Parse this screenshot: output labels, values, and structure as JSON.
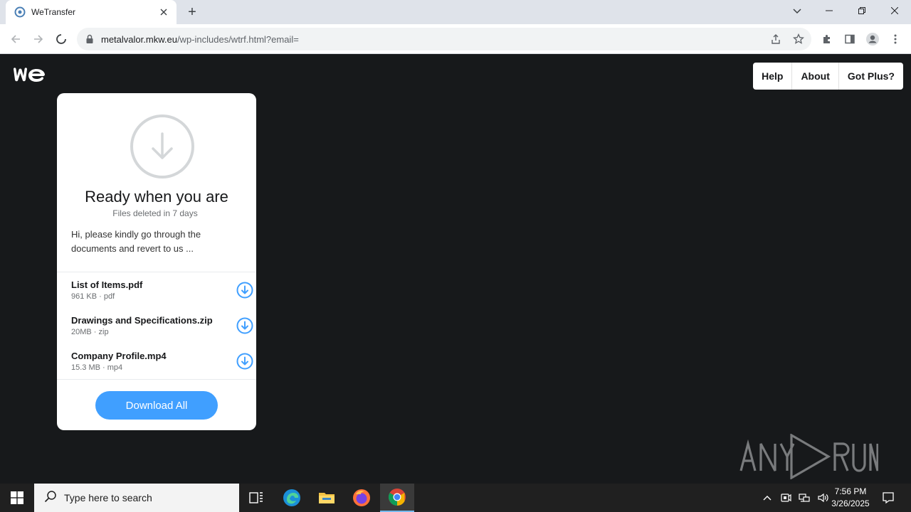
{
  "browser": {
    "tab_title": "WeTransfer",
    "new_tab_label": "+",
    "url_host": "metalvalor.mkw.eu",
    "url_path": "/wp-includes/wtrf.html?email="
  },
  "page": {
    "nav": [
      "Help",
      "About",
      "Got Plus?"
    ],
    "card": {
      "heading": "Ready when you are",
      "subheading": "Files deleted in 7 days",
      "message": "Hi, please kindly go through the documents and revert to us ...",
      "files": [
        {
          "name": "List of Items.pdf",
          "meta": "961 KB · pdf"
        },
        {
          "name": "Drawings and Specifications.zip",
          "meta": "20MB · zip"
        },
        {
          "name": "Company Profile.mp4",
          "meta": "15.3 MB · mp4"
        }
      ],
      "download_all": "Download All"
    },
    "watermark": "ANY RUN"
  },
  "taskbar": {
    "search_placeholder": "Type here to search",
    "time": "7:56 PM",
    "date": "3/26/2025"
  },
  "colors": {
    "page_bg": "#17191b",
    "accent": "#409fff",
    "taskbar": "#202020"
  }
}
